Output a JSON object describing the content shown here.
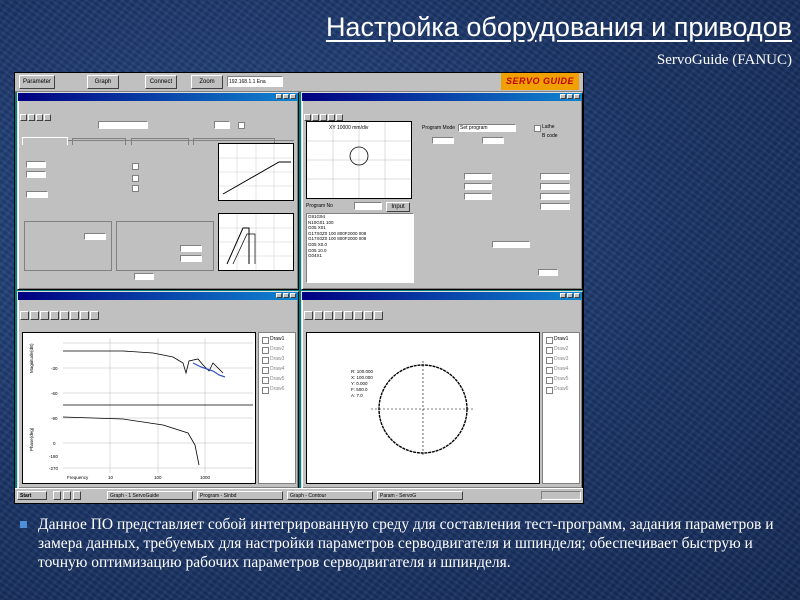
{
  "slide": {
    "title": "Настройка оборудования и приводов",
    "subtitle": "ServoGuide (FANUC)",
    "bullet": "Данное ПО представляет собой интегрированную среду для составления тест-программ, задания параметров и замера данных, требуемых для настройки параметров серводвигателя и шпинделя; обеспечивает быструю и точную оптимизацию рабочих параметров серводвигателя и шпинделя."
  },
  "colors": {
    "background": "#1d3a6e",
    "accent_bullet": "#4f8fd8",
    "desktop": "#008080",
    "logo_bg": "#f0a000",
    "logo_text": "#c00000"
  },
  "app": {
    "logo": "SERVO GUIDE",
    "topbar_buttons": [
      "Parameter",
      "Graph",
      "Connect",
      "Zoom"
    ],
    "topbar_field": "192.168.1.1 Ena",
    "program": {
      "mode_label": "Program Mode",
      "mode_value": "Set program",
      "lathe_label": "Lathe",
      "bcode_label": "B code",
      "plane_label": "XY 10000 mm/div",
      "program_no_label": "Program No",
      "input_button": "Input",
      "code_lines": [
        "G91G94",
        "N10G01 100",
        "G05 X01",
        "G17X0Z0 100 800F2000 008",
        "G17X0Z0 100 800F2000 008",
        "G05 X0.0",
        "G05 10.0",
        "G04X1"
      ],
      "circle_labels": [
        "Distance",
        "Length",
        "Feedrate",
        "Tapping",
        "M mode",
        "Radius",
        "Max acc",
        "Velocity",
        "Repeat",
        "Start Position"
      ],
      "high_precision_label": "High Precision Contour Mode",
      "sequence_label": "N Sequence number for Trigger"
    },
    "graph2_info": [
      "R: 100.000",
      "X: 100.000",
      "Y: 0.000",
      "F: 500.0",
      "A: 7.0"
    ],
    "graph1": {
      "ylabel_top": "Magnitude(dB)",
      "ylabel_bottom": "Phase(deg)",
      "xlabel": "Frequency",
      "yticks_top": [
        "-30",
        "-60",
        "-90"
      ],
      "yticks_bottom": [
        "0",
        "-180",
        "-270"
      ],
      "xticks": [
        "10",
        "100",
        "1000"
      ]
    },
    "legend_items": [
      "Draw1",
      "Draw2",
      "Draw3",
      "Draw4",
      "Draw5",
      "Draw6"
    ],
    "taskbar": {
      "start": "Start",
      "tasks": [
        "Graph - 1 ServoGuide",
        "Program - Sinbd",
        "Graph - Contour",
        "Param - ServoG"
      ]
    }
  }
}
